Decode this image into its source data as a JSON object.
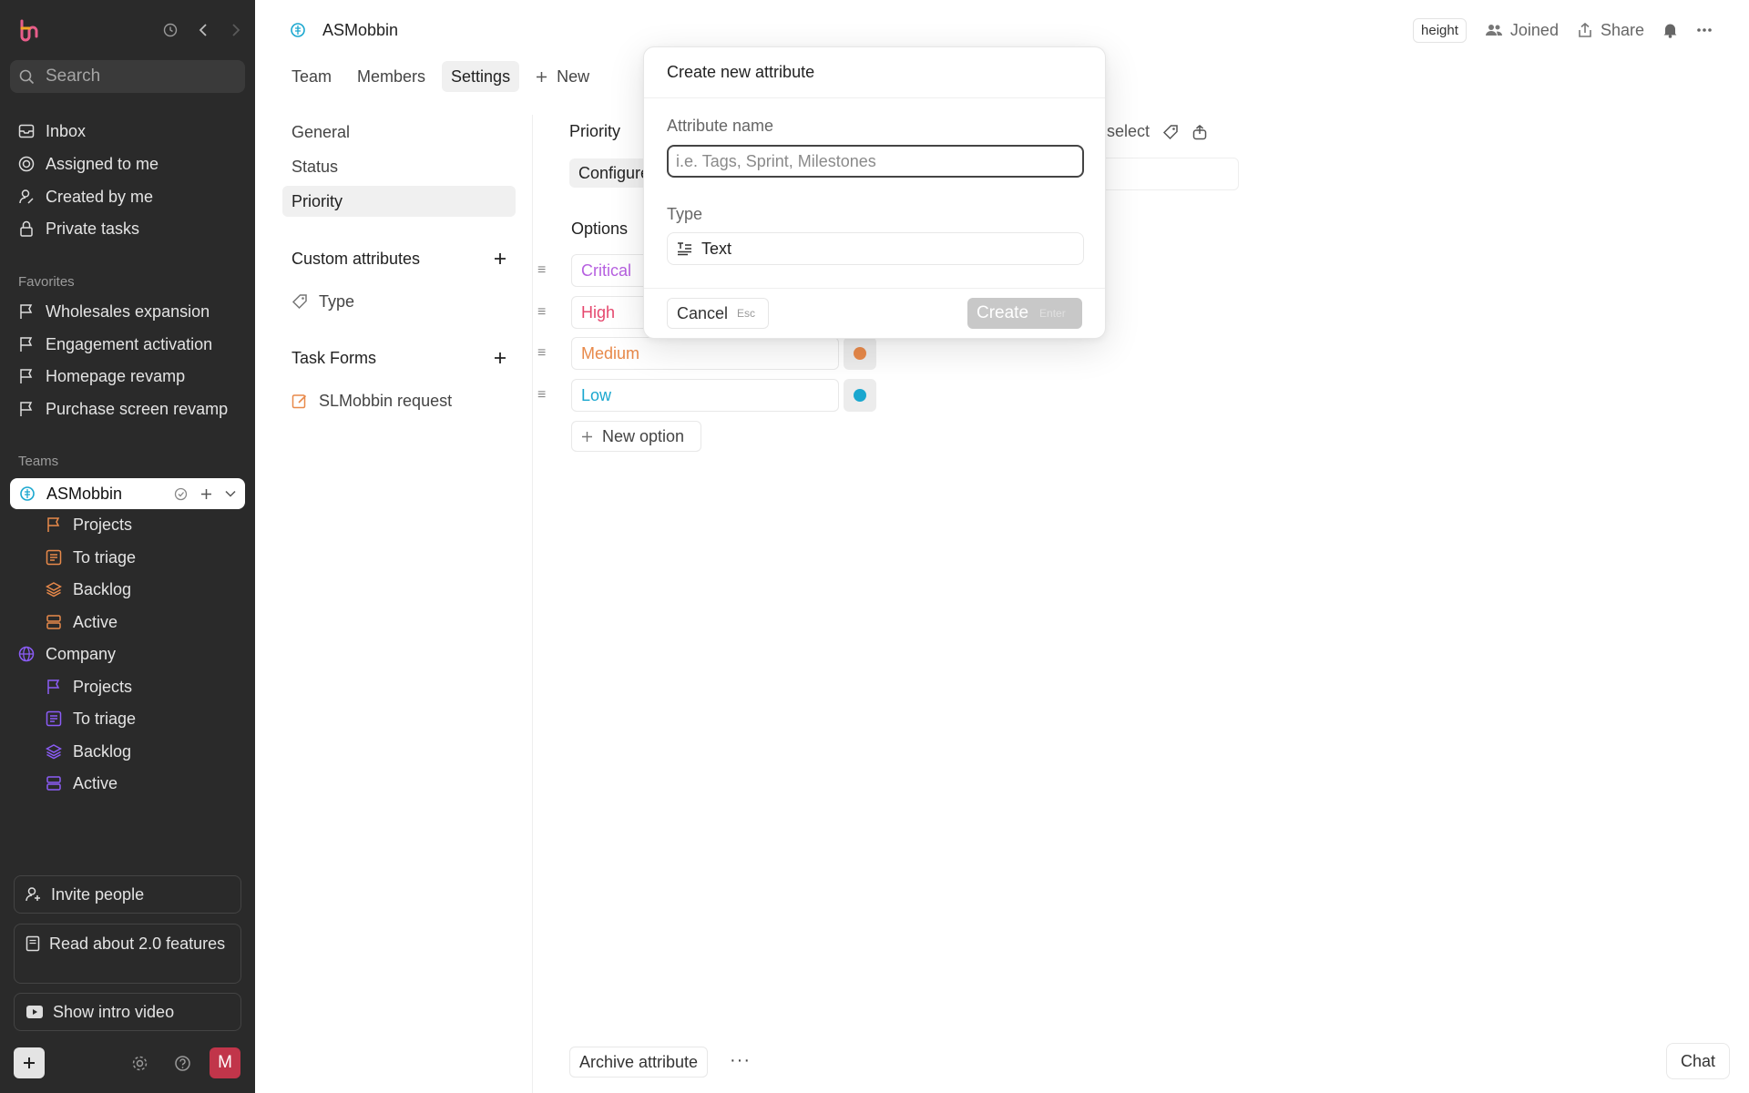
{
  "sidebar": {
    "search_placeholder": "Search",
    "nav": [
      {
        "label": "Inbox"
      },
      {
        "label": "Assigned to me"
      },
      {
        "label": "Created by me"
      },
      {
        "label": "Private tasks"
      }
    ],
    "favorites_heading": "Favorites",
    "favorites": [
      {
        "label": "Wholesales expansion"
      },
      {
        "label": "Engagement activation"
      },
      {
        "label": "Homepage revamp"
      },
      {
        "label": "Purchase screen revamp"
      }
    ],
    "teams_heading": "Teams",
    "team_active": "ASMobbin",
    "team_active_items": [
      {
        "label": "Projects"
      },
      {
        "label": "To triage"
      },
      {
        "label": "Backlog"
      },
      {
        "label": "Active"
      }
    ],
    "team_company": "Company",
    "team_company_items": [
      {
        "label": "Projects"
      },
      {
        "label": "To triage"
      },
      {
        "label": "Backlog"
      },
      {
        "label": "Active"
      }
    ],
    "invite": "Invite people",
    "read_about": "Read about 2.0 features",
    "intro_video": "Show intro video",
    "avatar_letter": "M"
  },
  "header": {
    "team_name": "ASMobbin",
    "height_badge": "height",
    "joined": "Joined",
    "share": "Share",
    "tabs": [
      {
        "label": "Team"
      },
      {
        "label": "Members"
      },
      {
        "label": "Settings"
      },
      {
        "label": "New"
      }
    ]
  },
  "settings_nav": {
    "items": [
      {
        "label": "General"
      },
      {
        "label": "Status"
      },
      {
        "label": "Priority"
      }
    ],
    "custom_attributes": "Custom attributes",
    "custom_items": [
      {
        "label": "Type"
      }
    ],
    "task_forms": "Task Forms",
    "form_items": [
      {
        "label": "SLMobbin request"
      }
    ]
  },
  "priority": {
    "title": "Priority",
    "configure": "Configure",
    "single_select": "le select",
    "options_label": "Options",
    "options": [
      {
        "label": "Critical",
        "color": "#b660e0"
      },
      {
        "label": "High",
        "color": "#e5486e"
      },
      {
        "label": "Medium",
        "color": "#e8894a"
      },
      {
        "label": "Low",
        "color": "#1aa7cf"
      }
    ],
    "new_option": "New option",
    "archive": "Archive attribute"
  },
  "modal": {
    "title": "Create new attribute",
    "name_label": "Attribute name",
    "name_placeholder": "i.e. Tags, Sprint, Milestones",
    "name_value": "",
    "type_label": "Type",
    "type_value": "Text",
    "cancel": "Cancel",
    "cancel_key": "Esc",
    "create": "Create",
    "create_key": "Enter"
  },
  "chat": "Chat",
  "colors": {
    "sidebar_bg": "#2a2a2a",
    "team_asmobbin": "#1aa7cf",
    "team_company": "#8b5cf6",
    "orange_icon": "#e8894a",
    "avatar": "#c1354a"
  }
}
